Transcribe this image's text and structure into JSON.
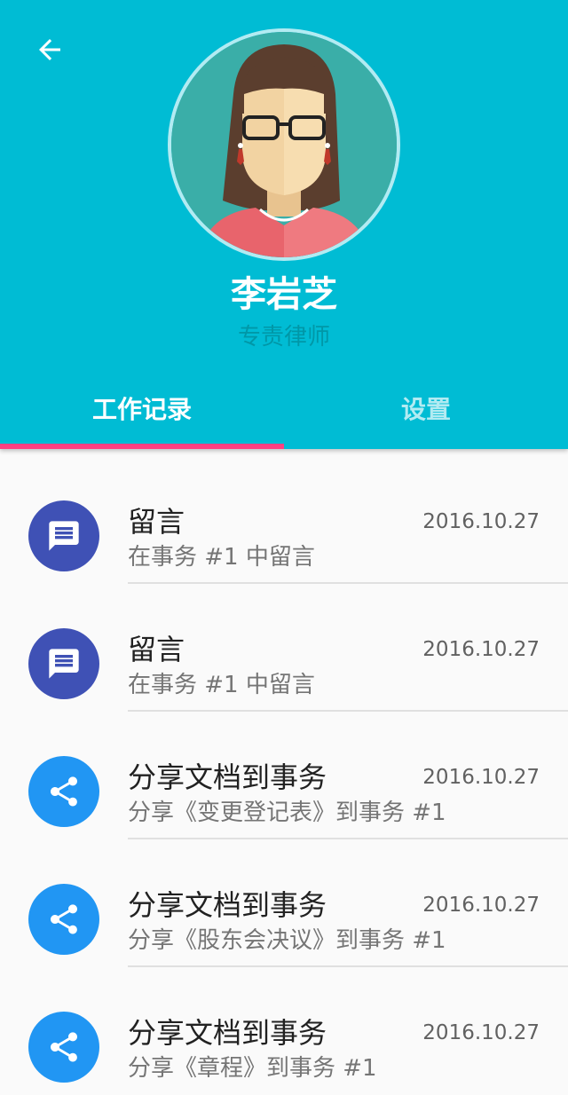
{
  "profile": {
    "name": "李岩芝",
    "title": "专责律师"
  },
  "header": {
    "background_color": "#00bcd4",
    "back_icon": "arrow-back-icon"
  },
  "tabs": [
    {
      "label": "工作记录",
      "active": true
    },
    {
      "label": "设置",
      "active": false
    }
  ],
  "colors": {
    "tab_indicator": "#ff4081",
    "message_icon_bg": "#3f51b5",
    "share_icon_bg": "#2196f3"
  },
  "records": [
    {
      "icon": "message-icon",
      "title": "留言",
      "subtitle": "在事务 #1 中留言",
      "date": "2016.10.27"
    },
    {
      "icon": "message-icon",
      "title": "留言",
      "subtitle": "在事务 #1 中留言",
      "date": "2016.10.27"
    },
    {
      "icon": "share-icon",
      "title": "分享文档到事务",
      "subtitle": "分享《变更登记表》到事务 #1",
      "date": "2016.10.27"
    },
    {
      "icon": "share-icon",
      "title": "分享文档到事务",
      "subtitle": "分享《股东会决议》到事务 #1",
      "date": "2016.10.27"
    },
    {
      "icon": "share-icon",
      "title": "分享文档到事务",
      "subtitle": "分享《章程》到事务 #1",
      "date": "2016.10.27"
    }
  ]
}
